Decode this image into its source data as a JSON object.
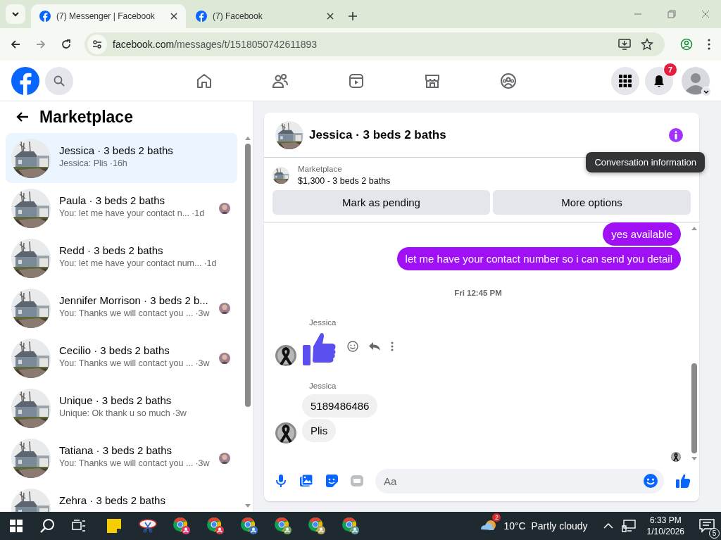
{
  "browser": {
    "tabs": [
      {
        "title": "(7) Messenger | Facebook",
        "selected": true
      },
      {
        "title": "(7) Facebook",
        "selected": false
      }
    ],
    "url": {
      "host": "facebook.com",
      "path": "/messages/t/1518050742611893"
    }
  },
  "topbar": {
    "nav": [
      {
        "kind": "home"
      },
      {
        "kind": "friends"
      },
      {
        "kind": "video"
      },
      {
        "kind": "marketplace"
      },
      {
        "kind": "groups"
      }
    ],
    "notification_count": "7"
  },
  "sidebar": {
    "title": "Marketplace",
    "conversations": [
      {
        "name": "Jessica · 3 beds 2 baths",
        "preview": "Jessica: Plis",
        "time": "·16h",
        "selected": true,
        "seen_avatar": false
      },
      {
        "name": "Paula · 3 beds 2 baths",
        "preview": "You: let me have your contact n...",
        "time": "·1d",
        "selected": false,
        "seen_avatar": true
      },
      {
        "name": "Redd · 3 beds 2 baths",
        "preview": "You: let me have your contact num...",
        "time": "·1d",
        "selected": false,
        "seen_avatar": false
      },
      {
        "name": "Jennifer Morrison · 3 beds 2 b...",
        "preview": "You: Thanks we will contact you ...",
        "time": "·3w",
        "selected": false,
        "seen_avatar": true
      },
      {
        "name": "Cecilio · 3 beds 2 baths",
        "preview": "You: Thanks we will contact you ...",
        "time": "·3w",
        "selected": false,
        "seen_avatar": true
      },
      {
        "name": "Unique · 3 beds 2 baths",
        "preview": "Unique: Ok thank u so much",
        "time": "·3w",
        "selected": false,
        "seen_avatar": false
      },
      {
        "name": "Tatiana · 3 beds 2 baths",
        "preview": "You: Thanks we will contact you ...",
        "time": "·3w",
        "selected": false,
        "seen_avatar": true
      },
      {
        "name": "Zehra · 3 beds 2 baths",
        "selected": false
      }
    ]
  },
  "chat": {
    "title": "Jessica · 3 beds 2 baths",
    "tooltip": "Conversation information",
    "listing": {
      "label": "Marketplace",
      "title": "$1,300 - 3 beds 2 baths"
    },
    "buttons": [
      "Mark as pending",
      "More options"
    ],
    "messages": [
      {
        "kind": "outgoing",
        "text": "yes  available"
      },
      {
        "kind": "outgoing",
        "text": "let me have your contact number so i can send you detail"
      },
      {
        "kind": "timestamp",
        "text": "Fri 12:45 PM"
      },
      {
        "kind": "sender",
        "text": "Jessica"
      },
      {
        "kind": "like"
      },
      {
        "kind": "sender",
        "text": "Jessica"
      },
      {
        "kind": "incoming",
        "text": "5189486486"
      },
      {
        "kind": "incoming",
        "text": "Plis",
        "avatar": true
      }
    ],
    "composer": {
      "placeholder": "Aa"
    }
  },
  "taskbar": {
    "apps": [
      {
        "kind": "notes"
      },
      {
        "kind": "snip"
      },
      {
        "kind": "chrome",
        "color": "#e0357a"
      },
      {
        "kind": "chrome",
        "color": "#d93a4a"
      },
      {
        "kind": "chrome",
        "color": "#3c78c8"
      },
      {
        "kind": "chrome",
        "color": "#7aa860"
      },
      {
        "kind": "chrome",
        "color": "#b8a860"
      },
      {
        "kind": "chrome",
        "color": "#5aa0a0"
      }
    ],
    "weather_badge": "2",
    "weather": "10°C  Partly cloudy",
    "time": "6:33 PM",
    "date": "1/10/2026",
    "notification_count": "5"
  }
}
